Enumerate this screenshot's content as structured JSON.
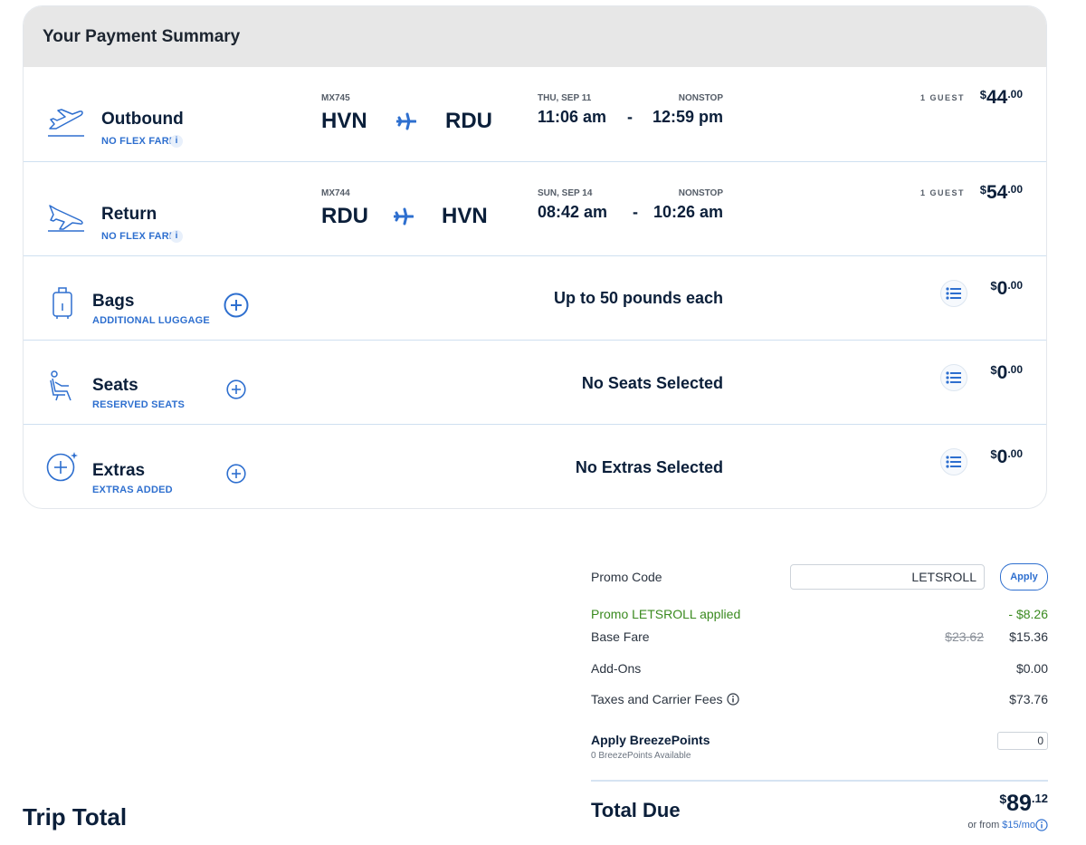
{
  "header": {
    "title": "Your Payment Summary"
  },
  "colors": {
    "accent": "#2e6fcf",
    "text": "#0b1f3a",
    "promo": "#3a8a1f"
  },
  "flights": [
    {
      "title": "Outbound",
      "fare": "NO FLEX FARE",
      "info": "i",
      "flight_no": "MX745",
      "from": "HVN",
      "to": "RDU",
      "date": "THU, SEP 11",
      "stops": "NONSTOP",
      "depart": "11:06 am",
      "dash": "-",
      "arrive": "12:59 pm",
      "guests": "1 GUEST",
      "price": {
        "cur": "$",
        "whole": "44",
        "cents": ".00"
      }
    },
    {
      "title": "Return",
      "fare": "NO FLEX FARE",
      "info": "i",
      "flight_no": "MX744",
      "from": "RDU",
      "to": "HVN",
      "date": "SUN, SEP 14",
      "stops": "NONSTOP",
      "depart": "08:42 am",
      "dash": "-",
      "arrive": "10:26 am",
      "guests": "1 GUEST",
      "price": {
        "cur": "$",
        "whole": "54",
        "cents": ".00"
      }
    }
  ],
  "addons": [
    {
      "title": "Bags",
      "sub": "ADDITIONAL LUGGAGE",
      "desc": "Up to 50 pounds each",
      "price": {
        "cur": "$",
        "whole": "0",
        "cents": ".00"
      }
    },
    {
      "title": "Seats",
      "sub": "RESERVED SEATS",
      "desc": "No Seats Selected",
      "price": {
        "cur": "$",
        "whole": "0",
        "cents": ".00"
      }
    },
    {
      "title": "Extras",
      "sub": "EXTRAS ADDED",
      "desc": "No Extras Selected",
      "price": {
        "cur": "$",
        "whole": "0",
        "cents": ".00"
      }
    }
  ],
  "summary": {
    "promo_label": "Promo Code",
    "promo_value": "LETSROLL",
    "apply_label": "Apply",
    "promo_applied_label": "Promo LETSROLL applied",
    "promo_applied_value": "- $8.26",
    "base_fare_label": "Base Fare",
    "base_fare_old": "$23.62",
    "base_fare_value": "$15.36",
    "addons_label": "Add-Ons",
    "addons_value": "$0.00",
    "taxes_label": "Taxes and Carrier Fees",
    "taxes_value": "$73.76",
    "points_label": "Apply BreezePoints",
    "points_available": "0 BreezePoints Available",
    "points_value": "0",
    "total_label": "Total Due",
    "total": {
      "cur": "$",
      "whole": "89",
      "cents": ".12"
    },
    "or_from": "or from",
    "monthly": "$15/mo"
  },
  "trip_total_label": "Trip Total"
}
